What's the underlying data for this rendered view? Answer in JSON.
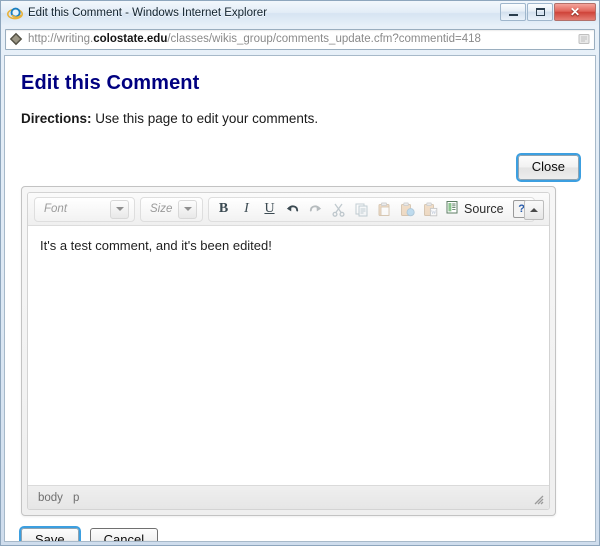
{
  "window": {
    "title": "Edit this Comment - Windows Internet Explorer",
    "logo_icon": "internet-explorer-icon",
    "buttons": {
      "minimize": "Minimize",
      "maximize": "Maximize",
      "close": "✕"
    }
  },
  "address_bar": {
    "favicon_icon": "site-favicon-diamond-icon",
    "url_scheme": "http://",
    "url_host_plain": "writing.",
    "url_host_bold": "colostate.edu",
    "url_path": "/classes/wikis_group/comments_update.cfm?commentid=418",
    "full_url": "http://writing.colostate.edu/classes/wikis_group/comments_update.cfm?commentid=418",
    "right_icon": "page-compatibility-icon"
  },
  "page": {
    "title": "Edit this Comment",
    "title_color": "#000080",
    "directions_label": "Directions:",
    "directions_text": " Use this page to edit your comments.",
    "close_label": "Close"
  },
  "editor": {
    "toolbar": {
      "font_label": "Font",
      "size_label": "Size",
      "bold_label": "B",
      "italic_label": "I",
      "underline_label": "U",
      "undo_icon": "undo-arrow-icon",
      "redo_icon": "redo-arrow-icon",
      "cut_icon": "cut-scissors-icon",
      "copy_icon": "copy-icon",
      "paste_icon": "paste-icon",
      "paste_text_icon": "paste-as-plain-text-icon",
      "paste_word_icon": "paste-from-word-icon",
      "source_icon": "source-document-icon",
      "source_label": "Source",
      "help_label": "?",
      "collapse_icon": "collapse-toolbar-icon"
    },
    "content": "It's a test comment, and it's been edited!",
    "statusbar": {
      "path": [
        "body",
        "p"
      ],
      "resizer_icon": "resize-grip-icon"
    }
  },
  "form": {
    "save_label": "Save",
    "cancel_label": "Cancel"
  }
}
